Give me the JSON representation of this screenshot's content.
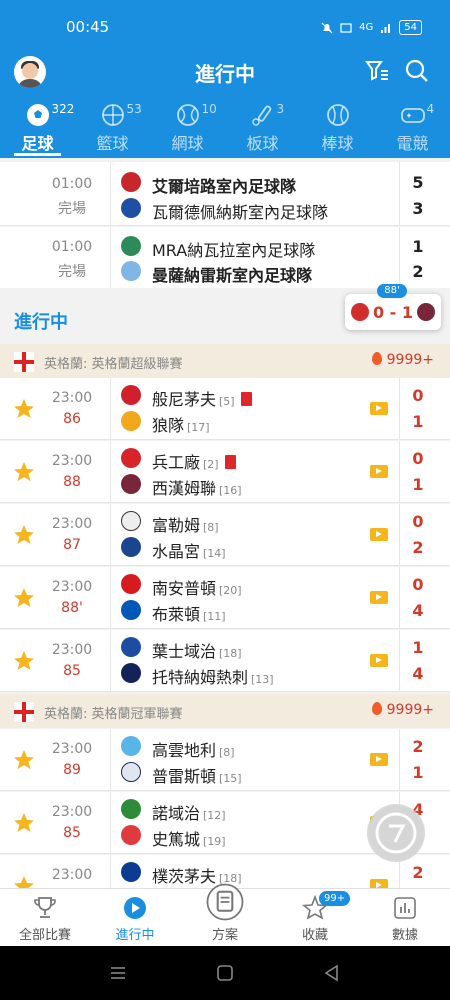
{
  "status_bar": {
    "time": "00:45",
    "network": "4G",
    "battery": "54"
  },
  "header": {
    "title": "進行中"
  },
  "tabs": [
    {
      "label": "足球",
      "count": "322",
      "icon": "soccer-ball-icon",
      "active": true
    },
    {
      "label": "籃球",
      "count": "53",
      "icon": "basketball-icon"
    },
    {
      "label": "網球",
      "count": "10",
      "icon": "tennis-icon"
    },
    {
      "label": "板球",
      "count": "3",
      "icon": "cricket-icon"
    },
    {
      "label": "棒球",
      "count": "",
      "icon": "baseball-icon"
    },
    {
      "label": "電競",
      "count": "4",
      "icon": "gamepad-icon"
    }
  ],
  "finished_matches": [
    {
      "time": "01:00",
      "status": "完場",
      "home": "艾爾培路室內足球隊",
      "away": "瓦爾德佩納斯室內足球隊",
      "home_score": "5",
      "away_score": "3",
      "home_bold": true
    },
    {
      "time": "01:00",
      "status": "完場",
      "home": "MRA納瓦拉室內足球隊",
      "away": "曼薩納雷斯室內足球隊",
      "home_score": "1",
      "away_score": "2",
      "away_bold": true
    }
  ],
  "live_section": {
    "title": "進行中"
  },
  "mini_score": {
    "minute": "88'",
    "score": "0 - 1"
  },
  "leagues": [
    {
      "name": "英格蘭: 英格蘭超級聯賽",
      "hot": "9999+",
      "matches": [
        {
          "time": "23:00",
          "minute": "86",
          "home": "般尼茅夫",
          "home_rank": "[5]",
          "home_red": true,
          "away": "狼隊",
          "away_rank": "[17]",
          "home_score": "0",
          "away_score": "1"
        },
        {
          "time": "23:00",
          "minute": "88",
          "home": "兵工廠",
          "home_rank": "[2]",
          "home_red": true,
          "away": "西漢姆聯",
          "away_rank": "[16]",
          "home_score": "0",
          "away_score": "1"
        },
        {
          "time": "23:00",
          "minute": "87",
          "home": "富勒姆",
          "home_rank": "[8]",
          "away": "水晶宮",
          "away_rank": "[14]",
          "home_score": "0",
          "away_score": "2"
        },
        {
          "time": "23:00",
          "minute": "88'",
          "home": "南安普頓",
          "home_rank": "[20]",
          "away": "布萊頓",
          "away_rank": "[11]",
          "home_score": "0",
          "away_score": "4"
        },
        {
          "time": "23:00",
          "minute": "85",
          "home": "葉士域治",
          "home_rank": "[18]",
          "away": "托特納姆熱刺",
          "away_rank": "[13]",
          "home_score": "1",
          "away_score": "4"
        }
      ]
    },
    {
      "name": "英格蘭: 英格蘭冠軍聯賽",
      "hot": "9999+",
      "matches": [
        {
          "time": "23:00",
          "minute": "89",
          "home": "高雲地利",
          "home_rank": "[8]",
          "away": "普雷斯頓",
          "away_rank": "[15]",
          "home_score": "2",
          "away_score": "1"
        },
        {
          "time": "23:00",
          "minute": "85",
          "home": "諾域治",
          "home_rank": "[12]",
          "away": "史篤城",
          "away_rank": "[19]",
          "home_score": "4",
          "away_score": "1"
        },
        {
          "time": "23:00",
          "minute": "",
          "home": "樸茨茅夫",
          "home_rank": "[18]",
          "away": "",
          "away_rank": "",
          "home_score": "2",
          "away_score": ""
        }
      ]
    }
  ],
  "bottom_nav": [
    {
      "label": "全部比賽",
      "icon": "trophy-icon"
    },
    {
      "label": "進行中",
      "icon": "play-circle-icon",
      "active": true
    },
    {
      "label": "方案",
      "icon": "document-icon"
    },
    {
      "label": "收藏",
      "icon": "star-outline-icon",
      "badge": "99+"
    },
    {
      "label": "數據",
      "icon": "bar-chart-icon"
    }
  ],
  "colors": {
    "primary": "#1a8fe0",
    "live_red": "#d23a2a",
    "star": "#f5b51c",
    "league_bg": "#f3ebdd"
  }
}
